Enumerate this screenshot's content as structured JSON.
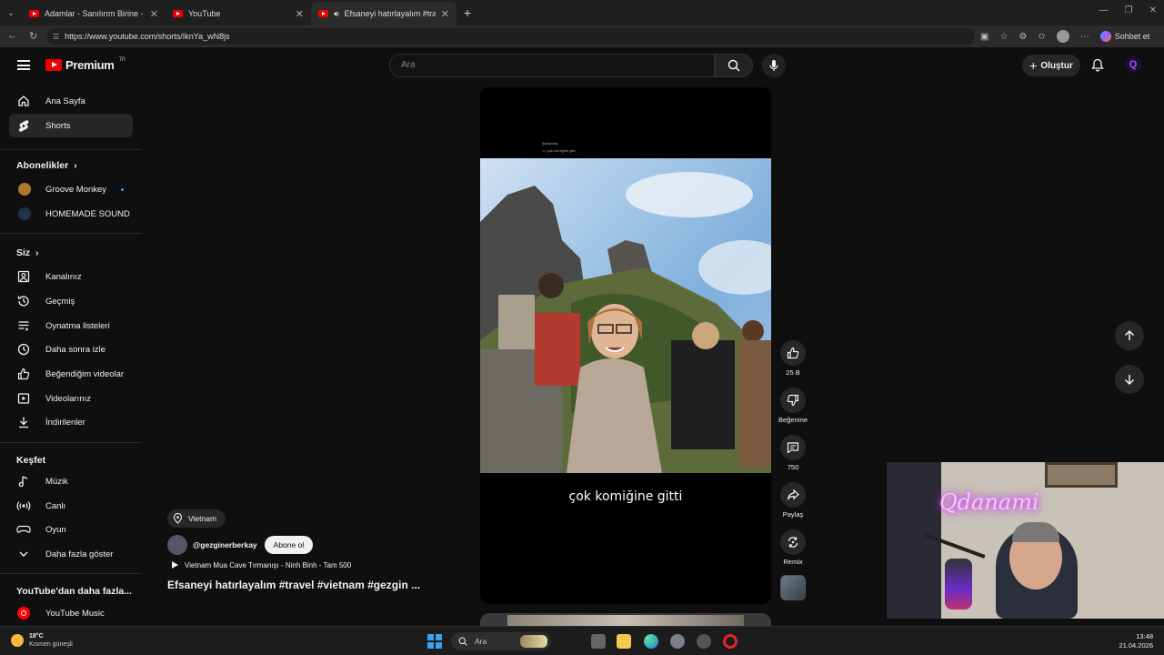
{
  "browser": {
    "tabs": [
      {
        "title": "Adamlar - Sanılırım Birine - YouTube"
      },
      {
        "title": "YouTube"
      },
      {
        "title": "Efsaneyi hatırlayalım #travel #"
      }
    ],
    "url": "https://www.youtube.com/shorts/IknYa_wN8js",
    "chat_label": "Sohbet et"
  },
  "header": {
    "logo": "Premium",
    "logo_region": "TR",
    "search_placeholder": "Ara",
    "create_label": "Oluştur"
  },
  "sidebar": {
    "home": "Ana Sayfa",
    "shorts": "Shorts",
    "subscriptions_title": "Abonelikler",
    "subscriptions": [
      {
        "name": "Groove Monkey",
        "new": true
      },
      {
        "name": "HOMEMADE SOUND",
        "new": false
      }
    ],
    "you_title": "Siz",
    "you_items": [
      "Kanalınız",
      "Geçmiş",
      "Oynatma listeleri",
      "Daha sonra izle",
      "Beğendiğim videolar",
      "Videolarınız",
      "İndirilenler"
    ],
    "explore_title": "Keşfet",
    "explore_items": [
      "Müzik",
      "Canlı",
      "Oyun",
      "Daha fazla göster"
    ],
    "more_title": "YouTube'dan daha fazla...",
    "more_items": [
      "YouTube Music"
    ]
  },
  "short": {
    "caption": "çok komiğine gitti",
    "tiny_line1": "[kahkaha]",
    "tiny_line2": ">> çok komiğine gitti.",
    "location": "Vietnam",
    "channel": "@gezginerberkay",
    "subscribe": "Abone ol",
    "music": "Vietnam Mua Cave Tırmanışı - Ninh Binh - Tam 500",
    "title": "Efsaneyi hatırlayalım  #travel #vietnam #gezgin ..."
  },
  "actions": {
    "likes": "25 B",
    "dislike": "Beğenme",
    "comments": "750",
    "share": "Paylaş",
    "remix": "Remix"
  },
  "webcam": {
    "neon_text": "Qdanami"
  },
  "taskbar": {
    "weather_temp": "18°C",
    "weather_desc": "Kısmen güneşli",
    "search": "Ara",
    "time": "13:48",
    "date": "21.04.2026"
  }
}
